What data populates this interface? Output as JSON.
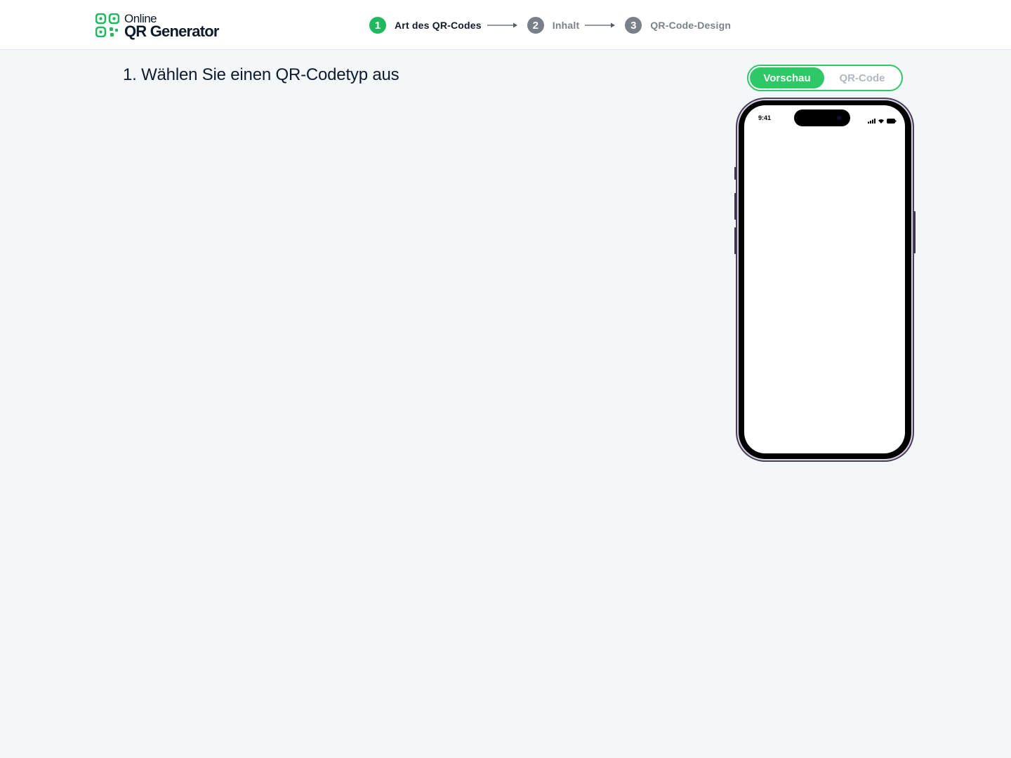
{
  "app": {
    "logo_line1": "Online",
    "logo_line2": "QR Generator"
  },
  "steps": [
    {
      "number": "1",
      "label": "Art des QR-Codes",
      "state": "active"
    },
    {
      "number": "2",
      "label": "Inhalt",
      "state": "inactive"
    },
    {
      "number": "3",
      "label": "QR-Code-Design",
      "state": "inactive"
    }
  ],
  "main": {
    "heading": "1. Wählen Sie einen QR-Codetyp aus"
  },
  "preview_toggle": {
    "preview_label": "Vorschau",
    "qrcode_label": "QR-Code",
    "selected": "Vorschau"
  },
  "phone": {
    "status_time": "9:41"
  },
  "colors": {
    "accent": "#21b95d",
    "toggle_green": "#2ec866",
    "inactive_step": "#79808a",
    "page_bg": "#f3f7fa"
  },
  "icons": {
    "logo": "qr-logo-icon",
    "step_arrow": "arrow-right-icon",
    "signal": "cellular-signal-icon",
    "wifi": "wifi-icon",
    "battery": "battery-icon"
  }
}
